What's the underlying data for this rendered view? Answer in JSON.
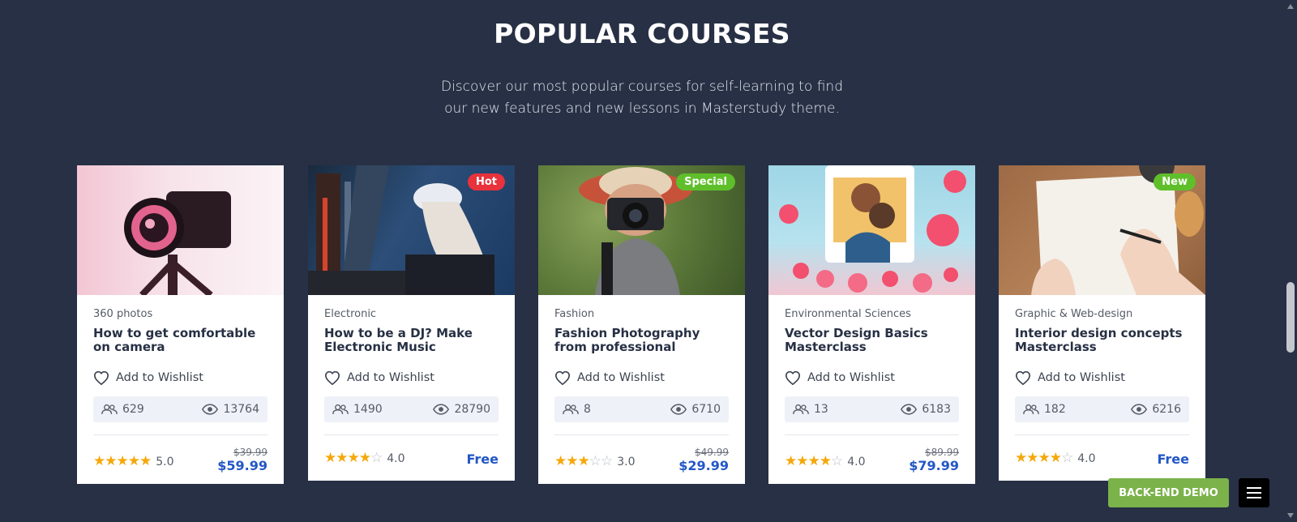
{
  "section": {
    "title": "POPULAR COURSES",
    "subtitle_line1": "Discover our most popular courses for self-learning to find",
    "subtitle_line2": "our new features and new lessons in Masterstudy theme."
  },
  "courses": [
    {
      "category": "360 photos",
      "title": "How to get comfortable on camera",
      "wishlist": "Add to Wishlist",
      "students": "629",
      "views": "13764",
      "rating": "5.0",
      "stars": 5,
      "old_price": "$39.99",
      "price": "$59.99",
      "badge": ""
    },
    {
      "category": "Electronic",
      "title": "How to be a DJ? Make Electronic Music",
      "wishlist": "Add to Wishlist",
      "students": "1490",
      "views": "28790",
      "rating": "4.0",
      "stars": 4,
      "price": "Free",
      "badge": "Hot"
    },
    {
      "category": "Fashion",
      "title": "Fashion Photography from professional",
      "wishlist": "Add to Wishlist",
      "students": "8",
      "views": "6710",
      "rating": "3.0",
      "stars": 3,
      "old_price": "$49.99",
      "price": "$29.99",
      "badge": "Special"
    },
    {
      "category": "Environmental Sciences",
      "title": "Vector Design Basics Masterclass",
      "wishlist": "Add to Wishlist",
      "students": "13",
      "views": "6183",
      "rating": "4.0",
      "stars": 4,
      "old_price": "$89.99",
      "price": "$79.99",
      "badge": ""
    },
    {
      "category": "Graphic & Web-design",
      "title": "Interior design concepts Masterclass",
      "wishlist": "Add to Wishlist",
      "students": "182",
      "views": "6216",
      "rating": "4.0",
      "stars": 4,
      "price": "Free",
      "badge": "New"
    }
  ],
  "colors": {
    "background": "#273044",
    "price": "#2357c6",
    "star": "#f5a80b",
    "badge_hot": "#e8323c",
    "badge_special": "#5fbf2b",
    "badge_new": "#5fbf2b",
    "demo_button": "#7bb24a"
  },
  "demo_button": "BACK-END DEMO",
  "icons": {
    "wishlist": "heart-icon",
    "students": "users-icon",
    "views": "eye-icon",
    "menu": "hamburger-menu-icon"
  }
}
